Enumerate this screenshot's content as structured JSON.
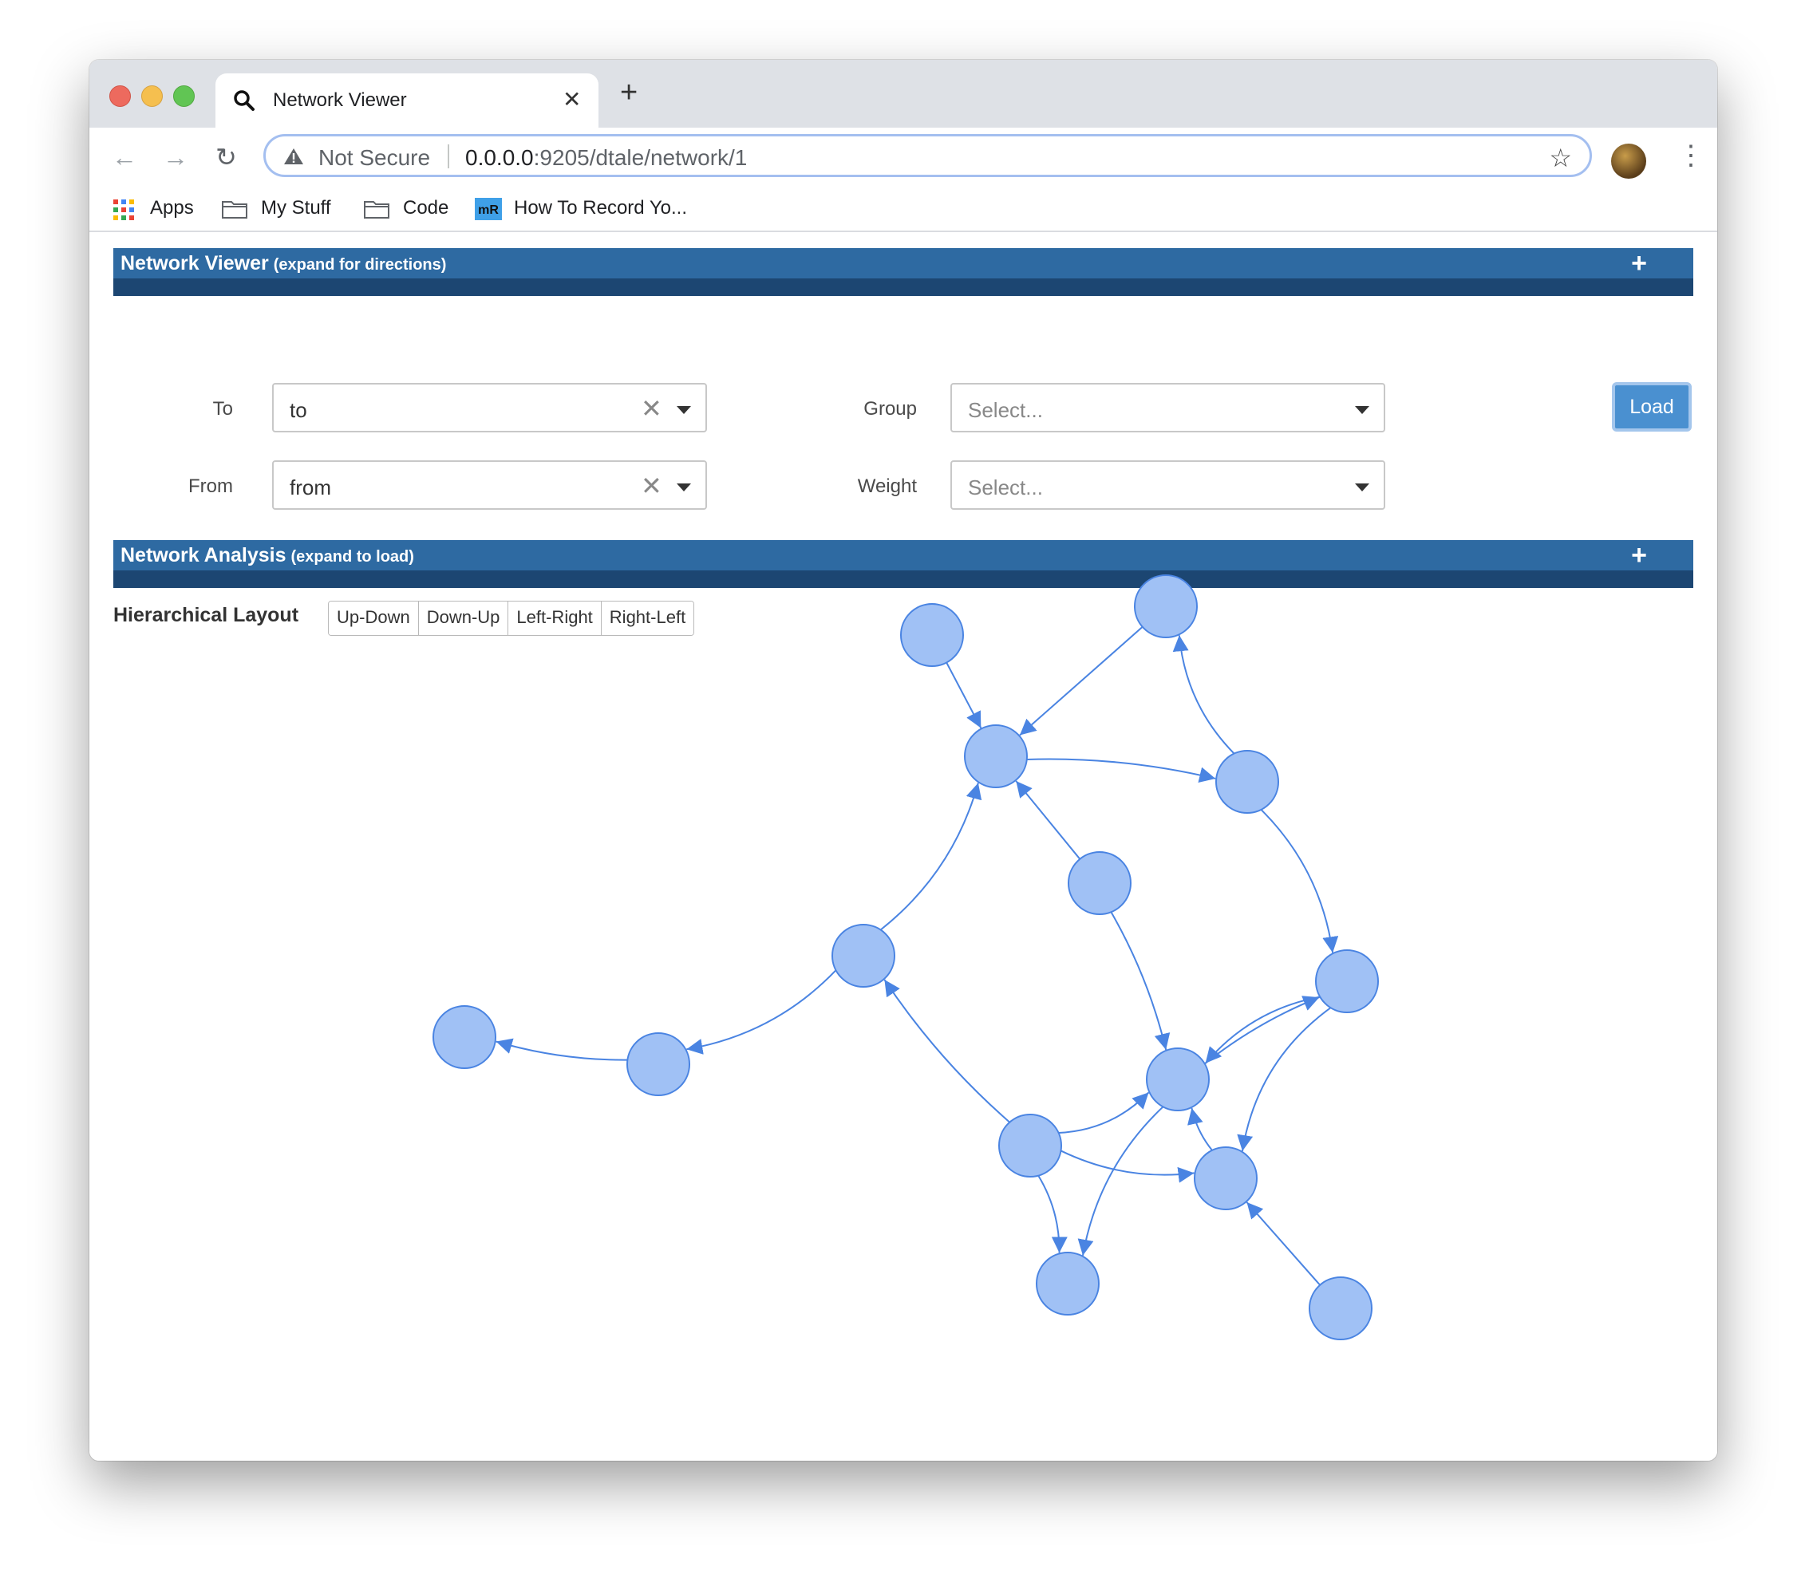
{
  "browser": {
    "tab_title": "Network Viewer",
    "new_tab": "+",
    "address": {
      "security": "Not Secure",
      "host": "0.0.0.0",
      "path": ":9205/dtale/network/1"
    },
    "bookmarks": [
      "Apps",
      "My Stuff",
      "Code",
      "How To Record Yo..."
    ]
  },
  "network_viewer": {
    "title": "Network Viewer",
    "subtitle": "(expand for directions)",
    "expand": "+",
    "fields": {
      "to_label": "To",
      "to_value": "to",
      "from_label": "From",
      "from_value": "from",
      "group_label": "Group",
      "group_placeholder": "Select...",
      "weight_label": "Weight",
      "weight_placeholder": "Select..."
    },
    "load_button": "Load"
  },
  "network_analysis": {
    "title": "Network Analysis",
    "subtitle": "(expand to load)",
    "expand": "+"
  },
  "hierarchical_layout": {
    "label": "Hierarchical Layout",
    "buttons": [
      "Up-Down",
      "Down-Up",
      "Left-Right",
      "Right-Left"
    ]
  },
  "graph": {
    "node_color": "#a0c1f5",
    "node_border": "#4a84e2",
    "edge_color": "#4a84e2"
  }
}
